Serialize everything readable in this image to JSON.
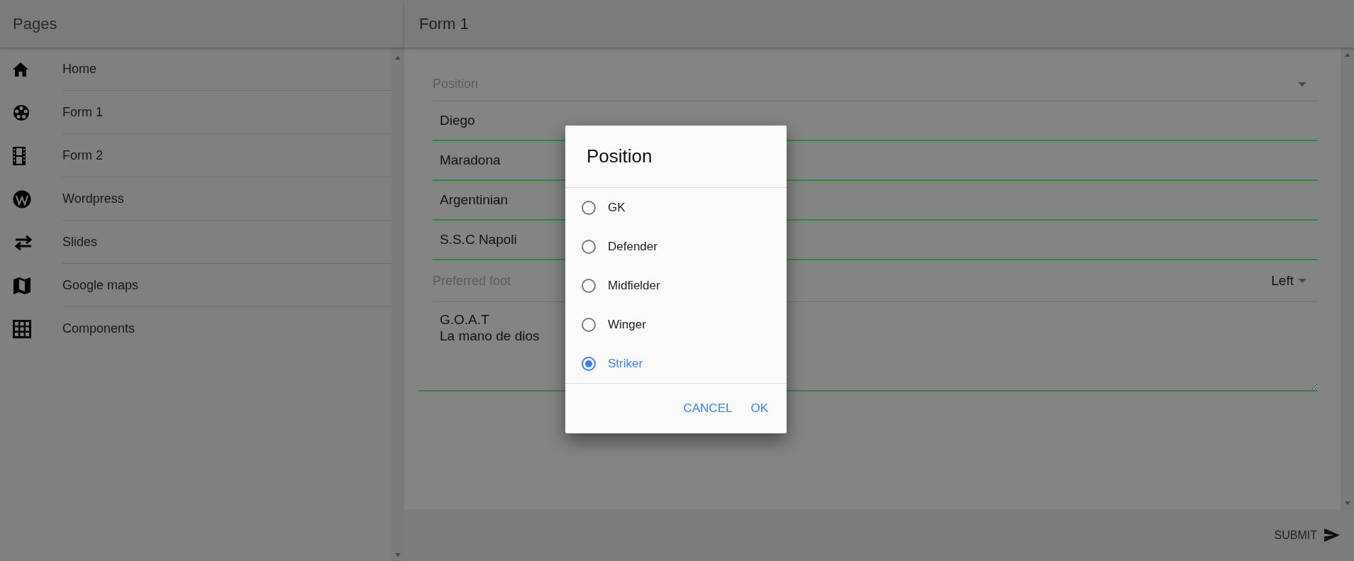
{
  "sidebar": {
    "title": "Pages",
    "items": [
      {
        "label": "Home",
        "kind": "home"
      },
      {
        "label": "Form 1",
        "kind": "ball"
      },
      {
        "label": "Form 2",
        "kind": "film"
      },
      {
        "label": "Wordpress",
        "kind": "wordpress"
      },
      {
        "label": "Slides",
        "kind": "swap"
      },
      {
        "label": "Google maps",
        "kind": "map"
      },
      {
        "label": "Components",
        "kind": "grid"
      }
    ]
  },
  "page_title": "Form 1",
  "form": {
    "position_select": {
      "placeholder": "Position"
    },
    "fields": [
      "Diego",
      "Maradona",
      "Argentinian",
      "S.S.C Napoli"
    ],
    "foot_select": {
      "label": "Preferred foot",
      "value": "Left"
    },
    "notes": "G.O.A.T\nLa mano de dios"
  },
  "submit": "SUBMIT",
  "dialog": {
    "title": "Position",
    "options": [
      {
        "label": "GK",
        "selected": false
      },
      {
        "label": "Defender",
        "selected": false
      },
      {
        "label": "Midfielder",
        "selected": false
      },
      {
        "label": "Winger",
        "selected": false
      },
      {
        "label": "Striker",
        "selected": true
      }
    ],
    "buttons": [
      "CANCEL",
      "OK"
    ]
  }
}
